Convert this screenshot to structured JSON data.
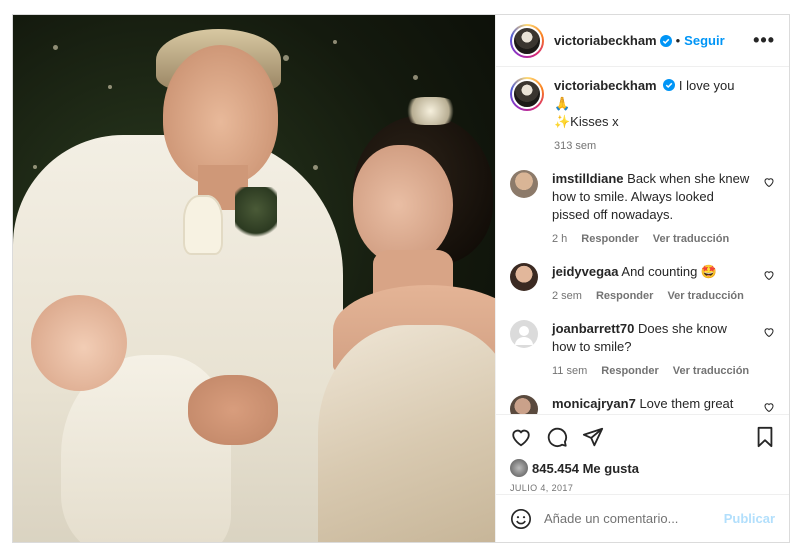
{
  "post": {
    "username": "victoriabeckham",
    "follow_label": "Seguir",
    "more_label": "•••",
    "caption_text": "I love you 🙏",
    "caption_line2": "✨Kisses x",
    "caption_time": "313 sem",
    "likes": "845.454 Me gusta",
    "date": "JULIO 4, 2017"
  },
  "comments": [
    {
      "user": "imstilldiane",
      "text": "Back when she knew how to smile. Always looked pissed off nowadays.",
      "time": "2 h",
      "reply": "Responder",
      "translate": "Ver traducción"
    },
    {
      "user": "jeidyvegaa",
      "text": "And counting 🤩",
      "time": "2 sem",
      "reply": "Responder",
      "translate": "Ver traducción"
    },
    {
      "user": "joanbarrett70",
      "text": "Does she know how to smile?",
      "time": "11 sem",
      "reply": "Responder",
      "translate": "Ver traducción"
    },
    {
      "user": "monicajryan7",
      "text": "Love them great couple she's a strong individual",
      "time": "",
      "reply": "",
      "translate": ""
    }
  ],
  "composer": {
    "placeholder": "Añade un comentario...",
    "post_label": "Publicar"
  },
  "icons": [
    "verified-icon",
    "more-icon",
    "heart-icon",
    "comment-icon",
    "share-icon",
    "bookmark-icon",
    "emoji-icon"
  ],
  "colors": {
    "link": "#0095f6",
    "muted": "#737373",
    "text": "#262626",
    "post_disabled": "#b2dffc",
    "verified": "#0095f6"
  }
}
